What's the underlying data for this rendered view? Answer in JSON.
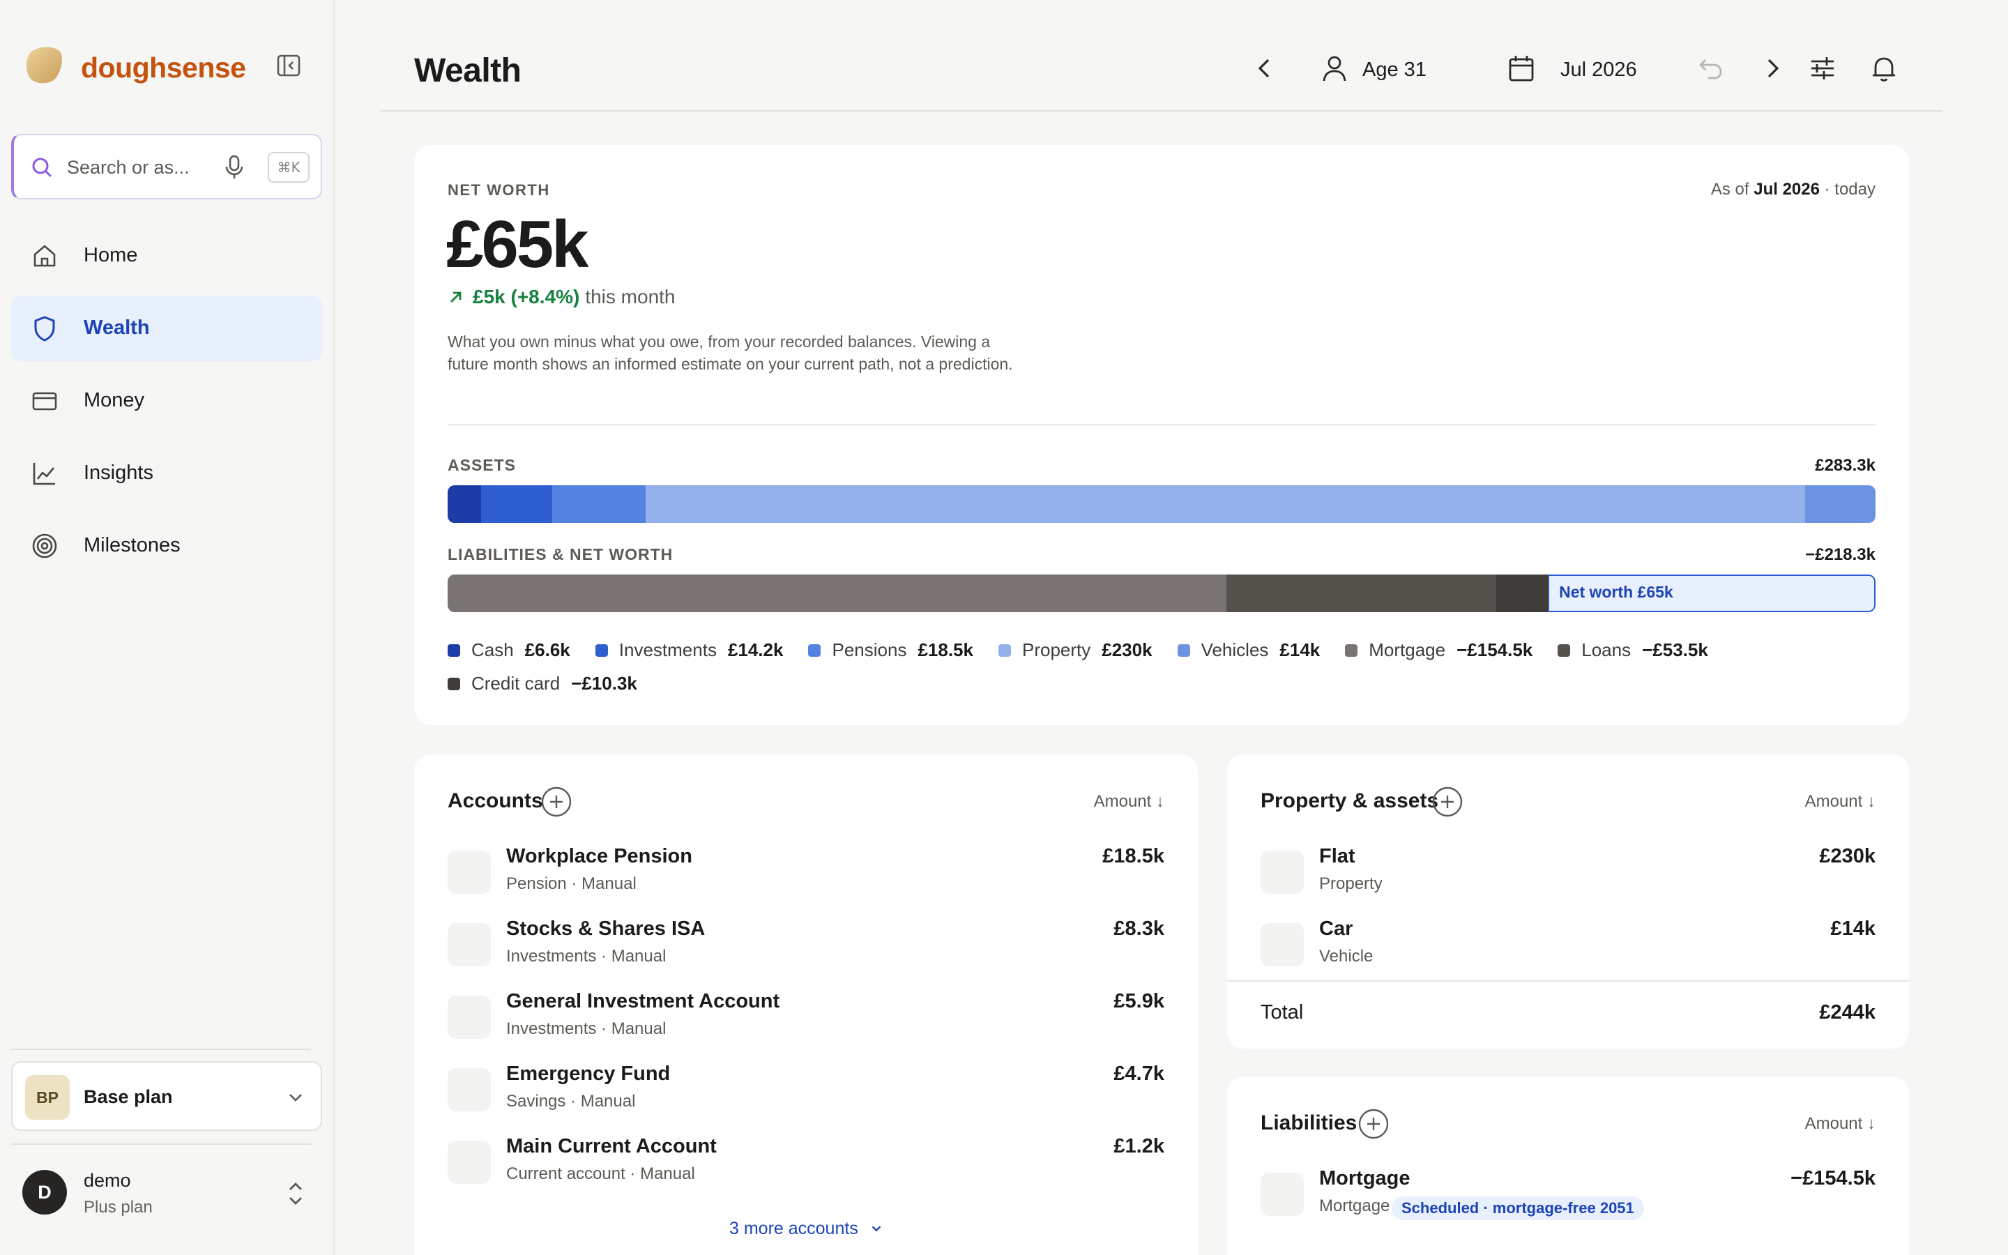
{
  "app": {
    "brand": "doughsense",
    "kbd_hint": "⌘K",
    "search_placeholder": "Search or as..."
  },
  "sidebar": {
    "items": [
      {
        "label": "Home",
        "icon": "home-icon"
      },
      {
        "label": "Wealth",
        "icon": "shield-icon",
        "active": true
      },
      {
        "label": "Money",
        "icon": "card-icon"
      },
      {
        "label": "Insights",
        "icon": "chart-icon"
      },
      {
        "label": "Milestones",
        "icon": "target-icon"
      }
    ],
    "plan": {
      "badge": "BP",
      "name": "Base plan"
    },
    "user": {
      "initial": "D",
      "name": "demo",
      "plan": "Plus plan"
    }
  },
  "header": {
    "title": "Wealth",
    "age": "Age 31",
    "date": "Jul 2026"
  },
  "net_worth": {
    "label": "NET WORTH",
    "as_of_prefix": "As of",
    "as_of_date": "Jul 2026",
    "as_of_suffix": "· today",
    "value": "£65k",
    "change": "£5k (+8.4%)",
    "change_period": "this month",
    "description": "What you own minus what you owe, from your recorded balances. Viewing a future month shows an informed estimate on your current path, not a prediction.",
    "assets_label": "ASSETS",
    "assets_total": "£283.3k",
    "liab_label": "LIABILITIES & NET WORTH",
    "liab_total": "−£218.3k",
    "net_worth_segment": "Net worth £65k",
    "assets_breakdown": [
      {
        "name": "Cash",
        "value": 6.6,
        "display": "£6.6k",
        "color": "#1d3ca8"
      },
      {
        "name": "Investments",
        "value": 14.2,
        "display": "£14.2k",
        "color": "#2f5ed0"
      },
      {
        "name": "Pensions",
        "value": 18.5,
        "display": "£18.5k",
        "color": "#5382e0"
      },
      {
        "name": "Property",
        "value": 230,
        "display": "£230k",
        "color": "#93b0eb"
      },
      {
        "name": "Vehicles",
        "value": 14,
        "display": "£14k",
        "color": "#6c93e2"
      }
    ],
    "liabilities_breakdown": [
      {
        "name": "Mortgage",
        "value": 154.5,
        "display": "−£154.5k",
        "color": "#797471"
      },
      {
        "name": "Loans",
        "value": 53.5,
        "display": "−£53.5k",
        "color": "#55514d"
      },
      {
        "name": "Credit card",
        "value": 10.3,
        "display": "−£10.3k",
        "color": "#3f3c39"
      }
    ],
    "net_worth_value": 65
  },
  "accounts": {
    "title": "Accounts",
    "sort_label": "Amount ↓",
    "items": [
      {
        "name": "Workplace Pension",
        "sub": "Pension · Manual",
        "amount": "£18.5k"
      },
      {
        "name": "Stocks & Shares ISA",
        "sub": "Investments · Manual",
        "amount": "£8.3k"
      },
      {
        "name": "General Investment Account",
        "sub": "Investments · Manual",
        "amount": "£5.9k"
      },
      {
        "name": "Emergency Fund",
        "sub": "Savings · Manual",
        "amount": "£4.7k"
      },
      {
        "name": "Main Current Account",
        "sub": "Current account · Manual",
        "amount": "£1.2k"
      }
    ],
    "more": "3 more accounts"
  },
  "property": {
    "title": "Property & assets",
    "sort_label": "Amount ↓",
    "items": [
      {
        "name": "Flat",
        "sub": "Property",
        "amount": "£230k"
      },
      {
        "name": "Car",
        "sub": "Vehicle",
        "amount": "£14k"
      }
    ],
    "total_label": "Total",
    "total": "£244k"
  },
  "liabilities": {
    "title": "Liabilities",
    "sort_label": "Amount ↓",
    "items": [
      {
        "name": "Mortgage",
        "sub": "Mortgage",
        "pill": "Scheduled · mortgage-free 2051",
        "amount": "−£154.5k"
      }
    ]
  }
}
